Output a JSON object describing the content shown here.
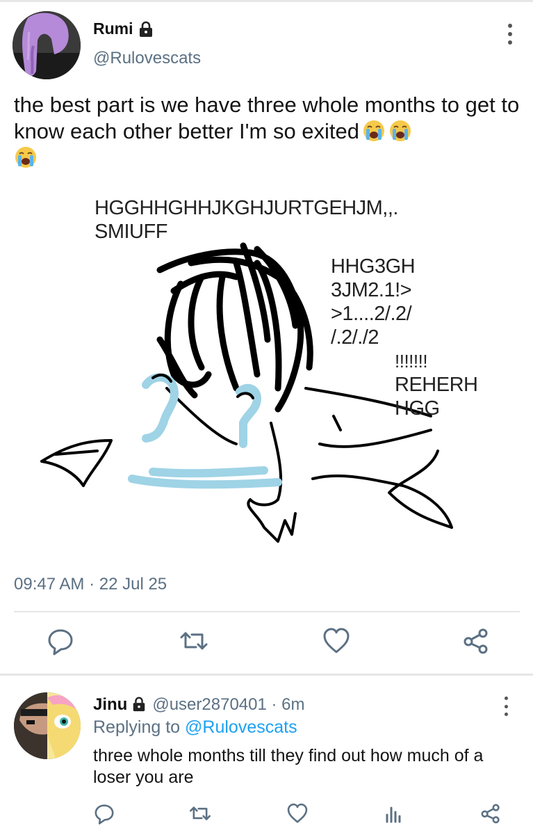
{
  "tweet": {
    "author_name": "Rumi",
    "author_handle": "@Rulovescats",
    "text": "the best part is we have three whole months to get to know each other better I'm so exited",
    "emoji": [
      "loudly-crying-face",
      "loudly-crying-face",
      "loudly-crying-face"
    ],
    "image_texts": {
      "line1": "HGGHHGHHJKGHJURTGEHJM,,.",
      "line2": "SMIUFF",
      "right1": "HHG3GH",
      "right2": "3JM2.1!>",
      "right3": ">1....2/.2/",
      "right4": "/.2/./2",
      "right5": "!!!!!!!",
      "right6": "REHERH",
      "right7": "HGG"
    },
    "timestamp": "09:47 AM · 22 Jul 25",
    "actions": [
      "reply-icon",
      "retweet-icon",
      "like-icon",
      "share-icon"
    ]
  },
  "reply": {
    "author_name": "Jinu",
    "handle_time": "@user2870401 · 6m",
    "replying_prefix": "Replying to",
    "replying_to": "@Rulovescats",
    "text": "three whole months till they find out how much of a loser you are",
    "actions": [
      "reply-icon",
      "retweet-icon",
      "like-icon",
      "analytics-icon",
      "share-icon"
    ]
  },
  "colors": {
    "secondary_text": "#5b7083",
    "link": "#1da1f2",
    "tear_blue": "#9fd3e6"
  }
}
